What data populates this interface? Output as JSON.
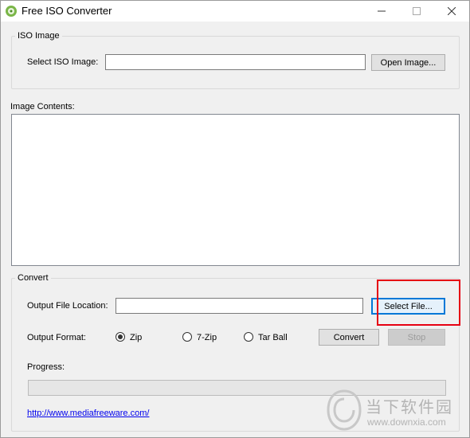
{
  "window": {
    "title": "Free ISO Converter",
    "controls": {
      "minimize": "—",
      "maximize": "☐",
      "close": "✕"
    }
  },
  "iso_group": {
    "label": "ISO Image",
    "select_label": "Select ISO Image:",
    "input_value": "",
    "open_button": "Open Image..."
  },
  "contents": {
    "label": "Image Contents:"
  },
  "convert_group": {
    "label": "Convert",
    "output_location_label": "Output File Location:",
    "output_location_value": "",
    "select_file_button": "Select File...",
    "output_format_label": "Output Format:",
    "formats": [
      {
        "label": "Zip",
        "checked": true
      },
      {
        "label": "7-Zip",
        "checked": false
      },
      {
        "label": "Tar Ball",
        "checked": false
      }
    ],
    "convert_button": "Convert",
    "stop_button": "Stop",
    "progress_label": "Progress:",
    "progress_value": 0
  },
  "footer": {
    "link": "http://www.mediafreeware.com/"
  },
  "watermark": {
    "site_cn": "当下软件园",
    "url": "www.downxia.com"
  },
  "colors": {
    "highlight": "#e60012",
    "link": "#0000ee",
    "focus": "#0078d7"
  }
}
